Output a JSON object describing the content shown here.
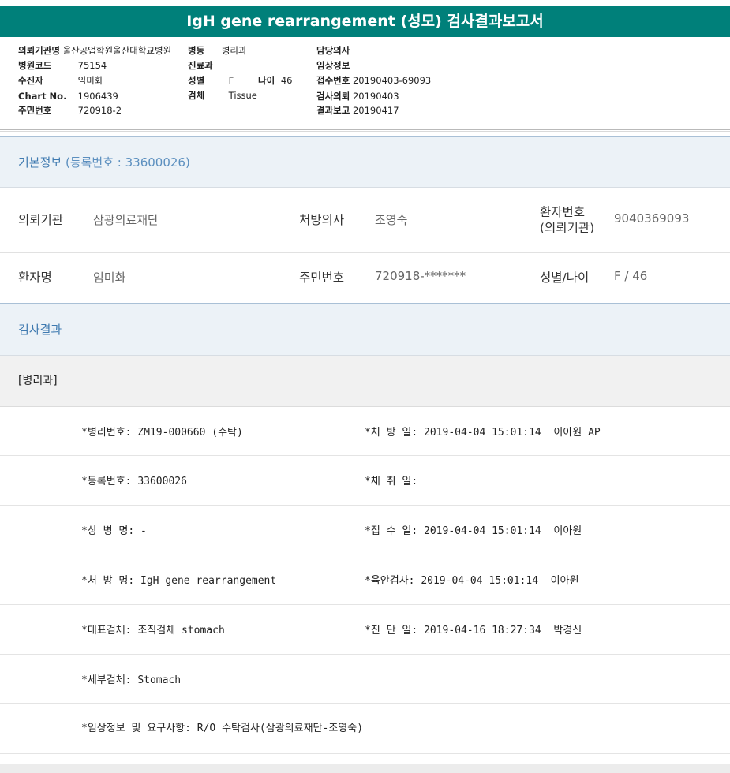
{
  "report_title": "IgH gene rearrangement (성모) 검사결과보고서",
  "header": {
    "req_institution_label": "의뢰기관명",
    "req_institution": "울산공업학원울산대학교병원",
    "ward_label": "병동",
    "ward": "병리과",
    "attending_label": "담당의사",
    "attending": "",
    "hospital_code_label": "병원코드",
    "hospital_code": "75154",
    "department_label": "진료과",
    "department": "",
    "clinical_info_label": "임상정보",
    "clinical_info": "",
    "collector_label": "수진자",
    "collector": "임미화",
    "sex_label": "성별",
    "sex": "F",
    "age_label": "나이",
    "age": "46",
    "receipt_no_label": "접수번호",
    "receipt_no": "20190403-69093",
    "chart_no_label": "Chart No.",
    "chart_no": "1906439",
    "specimen_label": "검체",
    "specimen": "Tissue",
    "test_request_label": "검사의뢰",
    "test_request": "20190403",
    "resident_no_label": "주민번호",
    "resident_no": "720918-2",
    "result_report_label": "결과보고",
    "result_report": "20190417"
  },
  "basic_info": {
    "title": "기본정보",
    "reg_note": "(등록번호 : 33600026)",
    "req_institution_label": "의뢰기관",
    "req_institution": "삼광의료재단",
    "prescriber_label": "처방의사",
    "prescriber": "조영숙",
    "patient_no_label_1": "환자번호",
    "patient_no_label_2": "(의뢰기관)",
    "patient_no": "9040369093",
    "patient_name_label": "환자명",
    "patient_name": "임미화",
    "resident_no_label": "주민번호",
    "resident_no": "720918-*******",
    "sex_age_label": "성별/나이",
    "sex_age": "F / 46"
  },
  "results": {
    "title": "검사결과",
    "department": "[병리과]",
    "rows": [
      {
        "left": "*병리번호: ZM19-000660 (수탁)",
        "right": "*처 방 일: 2019-04-04 15:01:14  이아원 AP"
      },
      {
        "left": "*등록번호: 33600026",
        "right": "*채 취 일:"
      },
      {
        "left": "*상 병 명: -",
        "right": "*접 수 일: 2019-04-04 15:01:14  이아원"
      },
      {
        "left": "*처 방 명: IgH gene rearrangement",
        "right": "*육안검사: 2019-04-04 15:01:14  이아원"
      },
      {
        "left": "*대표검체: 조직검체 stomach",
        "right": "*진 단 일: 2019-04-16 18:27:34  박경신"
      },
      {
        "left": "*세부검체: Stomach",
        "right": ""
      },
      {
        "left": "*임상정보 및 요구사항: R/O 수탁검사(삼광의료재단-조영숙)",
        "right": ""
      }
    ]
  }
}
